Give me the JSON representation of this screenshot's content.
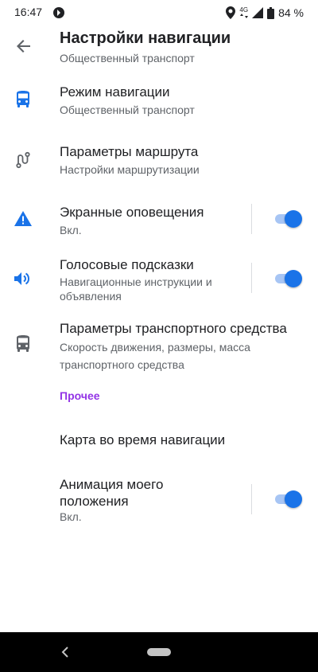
{
  "status_bar": {
    "time": "16:47",
    "network_label": "4G",
    "battery": "84 %"
  },
  "app_bar": {
    "title": "Настройки навигации",
    "subtitle": "Общественный транспорт"
  },
  "settings": [
    {
      "title": "Режим навигации",
      "subtitle": "Общественный транспорт",
      "icon": "bus-icon"
    },
    {
      "title": "Параметры маршрута",
      "subtitle": "Настройки маршрутизации",
      "icon": "route-icon"
    },
    {
      "title": "Экранные оповещения",
      "subtitle": "Вкл.",
      "icon": "warning-icon",
      "toggle_on": true
    },
    {
      "title": "Голосовые подсказки",
      "subtitle": "Навигационные инструкции и объявления",
      "icon": "speaker-icon",
      "toggle_on": true
    },
    {
      "title": "Параметры транспортного средства",
      "subtitle": "Скорость движения, размеры, масса транспортного средства",
      "icon": "vehicle-icon"
    }
  ],
  "section_other": {
    "header": "Прочее",
    "items": [
      {
        "title": "Карта во время навигации"
      },
      {
        "title": "Анимация моего положения",
        "subtitle": "Вкл.",
        "toggle_on": true
      }
    ]
  },
  "colors": {
    "accent_blue": "#1a73e8",
    "section_purple": "#9334e6",
    "icon_gray": "#5f6368"
  }
}
